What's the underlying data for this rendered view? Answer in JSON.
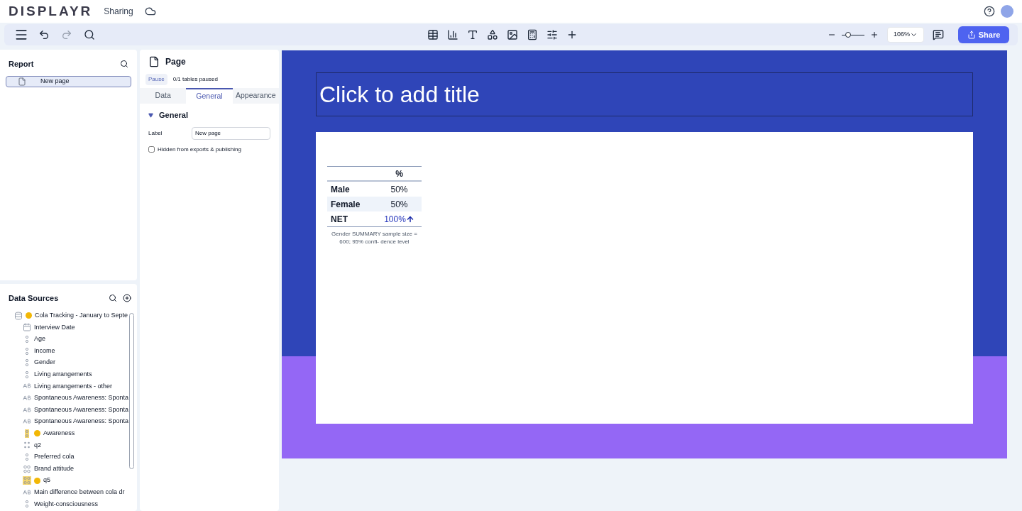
{
  "app": {
    "logo": "DISPLAYR",
    "document": "Sharing"
  },
  "toolbar": {
    "zoom": "106%",
    "zoom_slider": {
      "level": 0.2
    },
    "share": "Share"
  },
  "report": {
    "title": "Report",
    "pages": [
      {
        "label": "New page",
        "selected": true
      }
    ]
  },
  "data_sources": {
    "title": "Data Sources",
    "items": [
      {
        "kind": "dataset",
        "label": "Cola Tracking - January to Septe",
        "warning": true
      },
      {
        "kind": "date",
        "label": "Interview Date",
        "warning": false
      },
      {
        "kind": "nominal",
        "label": "Age",
        "warning": false
      },
      {
        "kind": "nominal",
        "label": "Income",
        "warning": false
      },
      {
        "kind": "nominal",
        "label": "Gender",
        "warning": false
      },
      {
        "kind": "nominal",
        "label": "Living arrangements",
        "warning": false
      },
      {
        "kind": "text",
        "label": "Living arrangements - other",
        "warning": false
      },
      {
        "kind": "text",
        "label": "Spontaneous Awareness: Sponta",
        "warning": false
      },
      {
        "kind": "text",
        "label": "Spontaneous Awareness: Sponta",
        "warning": false
      },
      {
        "kind": "text",
        "label": "Spontaneous Awareness: Sponta",
        "warning": false
      },
      {
        "kind": "multi",
        "label": "Awareness",
        "warning": true
      },
      {
        "kind": "numeric_multi",
        "label": "q2",
        "warning": false
      },
      {
        "kind": "nominal",
        "label": "Preferred cola",
        "warning": false
      },
      {
        "kind": "grid",
        "label": "Brand attitude",
        "warning": false
      },
      {
        "kind": "multi_grid",
        "label": "q5",
        "warning": true
      },
      {
        "kind": "text",
        "label": "Main difference between cola dr",
        "warning": false
      },
      {
        "kind": "nominal",
        "label": "Weight-consciousness",
        "warning": false
      }
    ]
  },
  "properties": {
    "title": "Page",
    "pause": "Pause",
    "paused_status": "0/1 tables paused",
    "tabs": [
      {
        "label": "Data",
        "selected": false
      },
      {
        "label": "General",
        "selected": true
      },
      {
        "label": "Appearance",
        "selected": false
      }
    ],
    "section": {
      "title": "General",
      "expanded": true
    },
    "label_field": {
      "label": "Label",
      "value": "New page"
    },
    "hidden_checkbox": {
      "label": "Hidden from exports & publishing",
      "checked": false
    }
  },
  "slide": {
    "title_placeholder": "Click to add title",
    "table": {
      "columns": [
        "%"
      ],
      "rows": [
        {
          "label": "Male",
          "value": "50%",
          "shaded": false,
          "significant": false
        },
        {
          "label": "Female",
          "value": "50%",
          "shaded": true,
          "significant": false
        },
        {
          "label": "NET",
          "value": "100%",
          "shaded": false,
          "significant": true
        }
      ],
      "footer": "Gender SUMMARY sample size = 600; 95% confi- dence level"
    }
  }
}
